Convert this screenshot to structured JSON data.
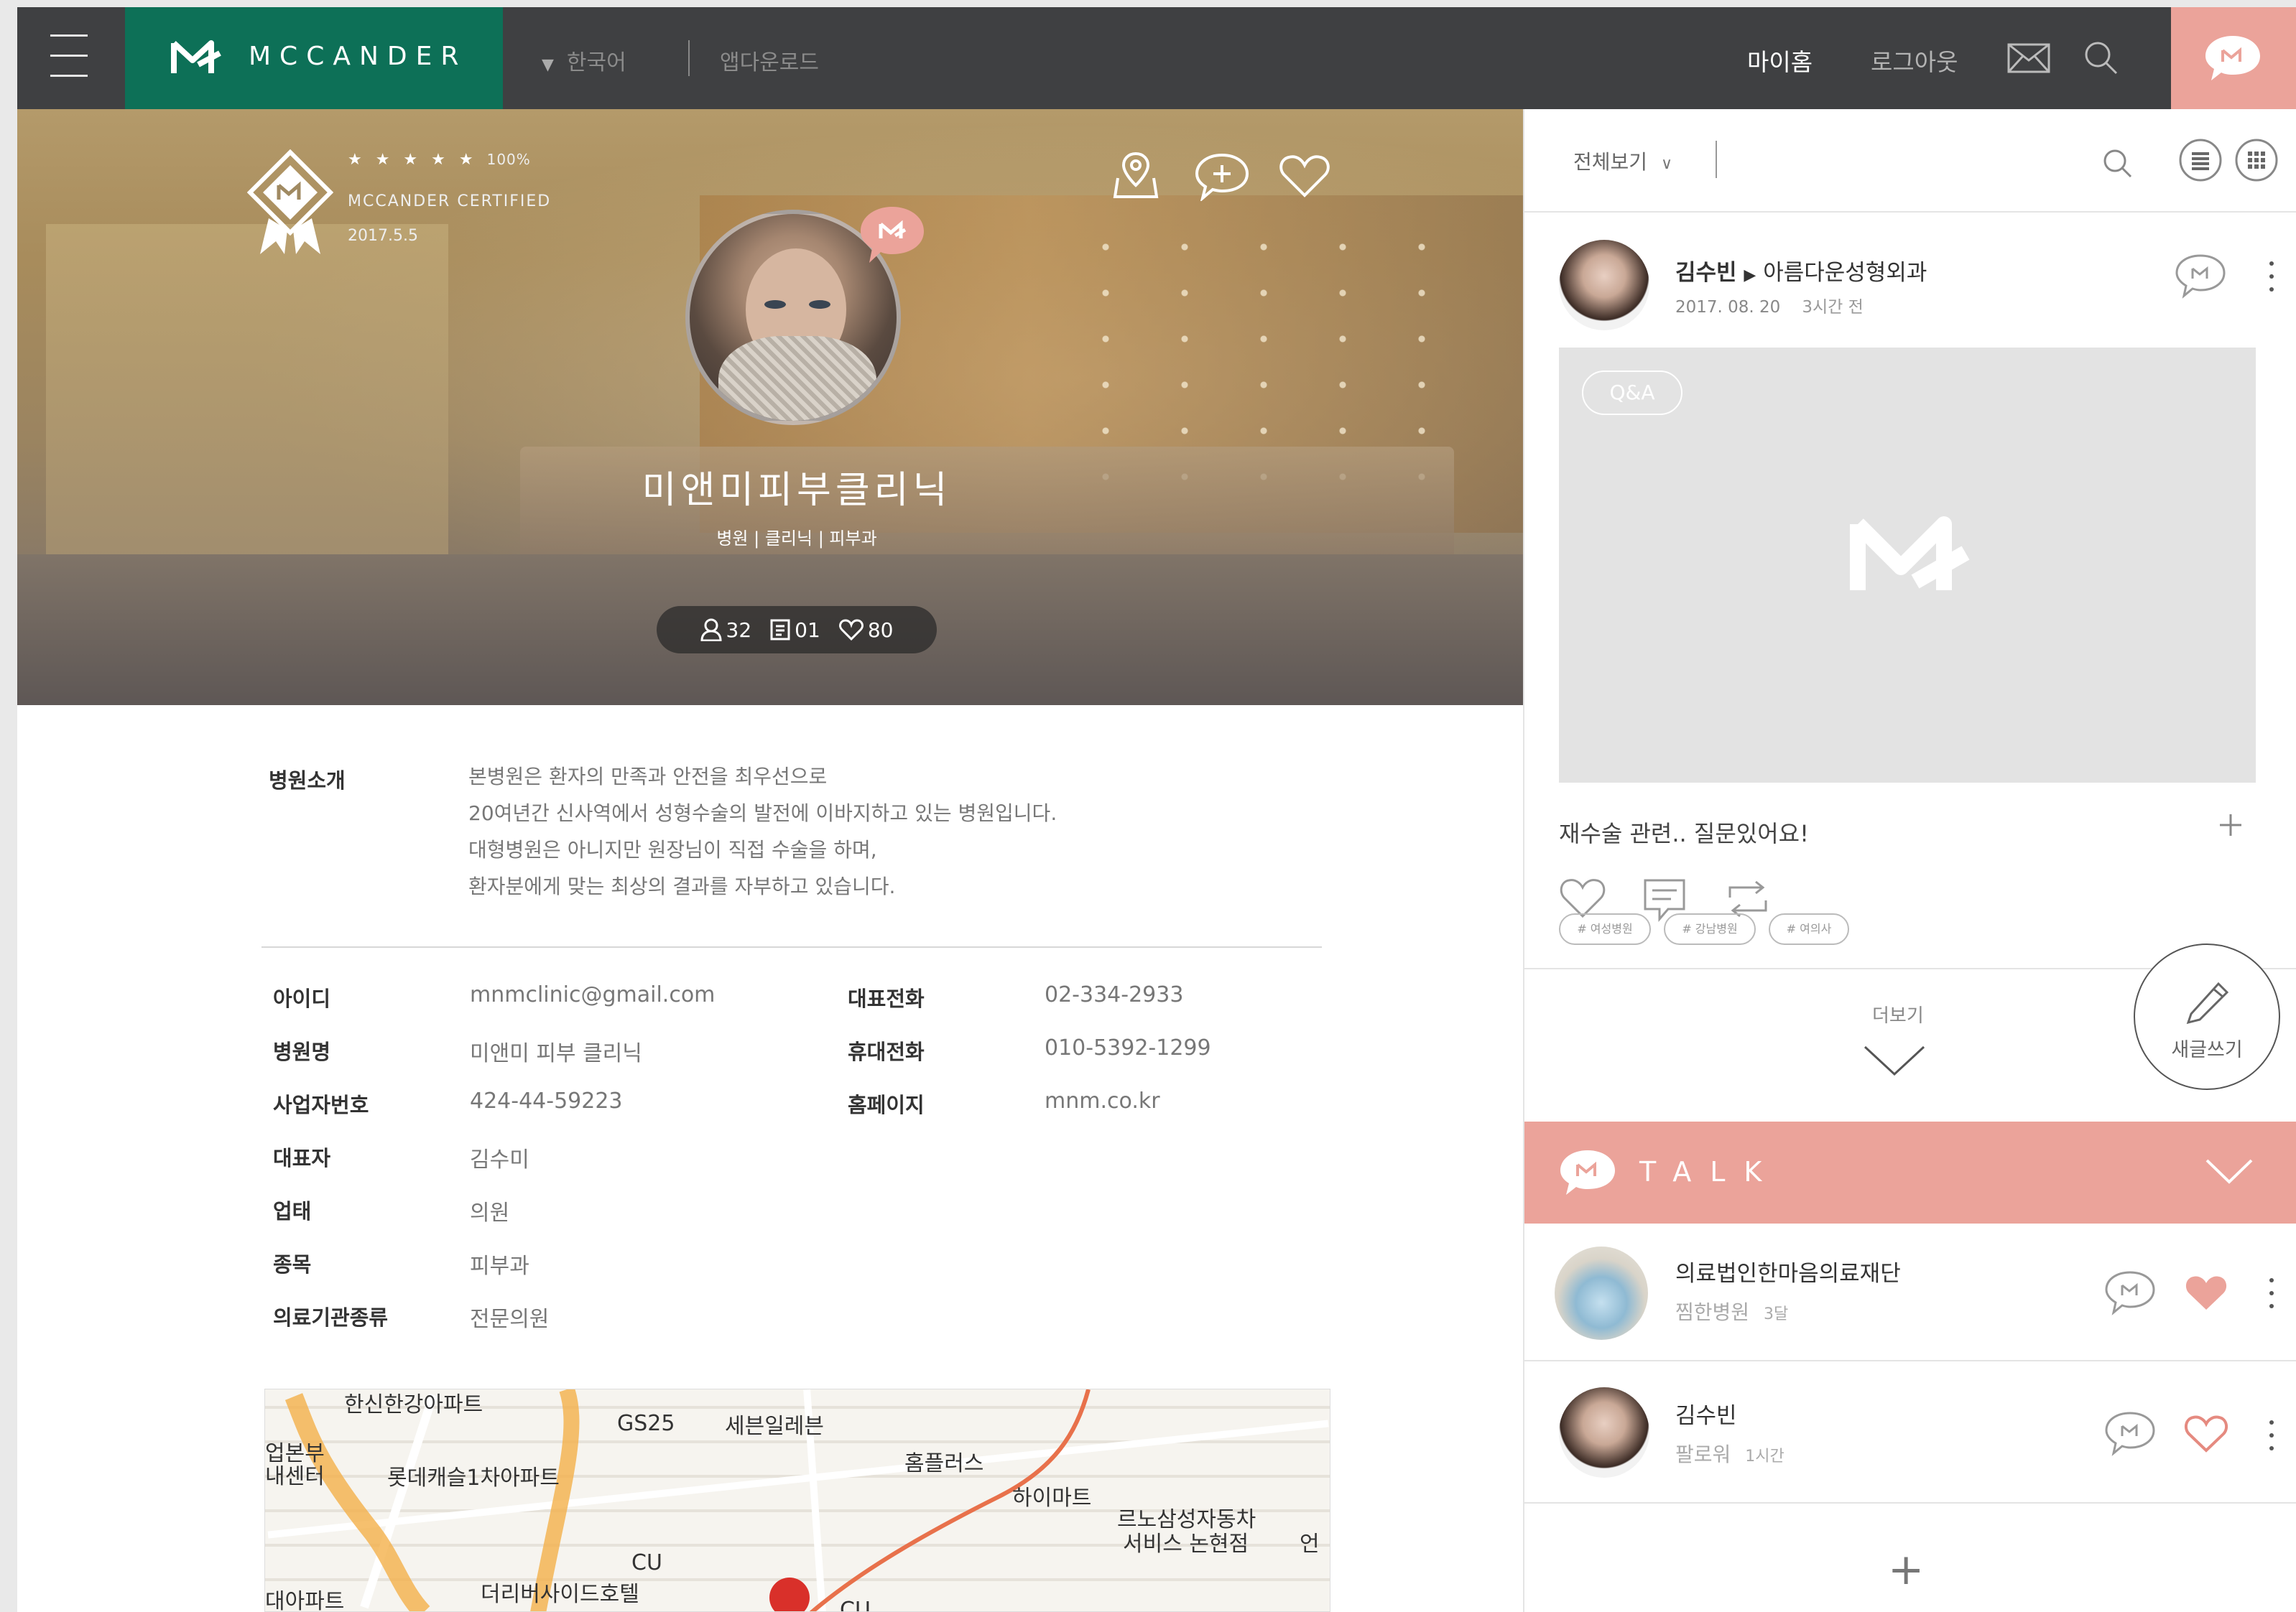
{
  "header": {
    "brand": "MCCANDER",
    "language": "한국어",
    "app_download": "앱다운로드",
    "my_home": "마이홈",
    "logout": "로그아웃"
  },
  "profile": {
    "rating_stars": 5,
    "rating_percent": "100%",
    "certified": "MCCANDER CERTIFIED",
    "certified_date": "2017.5.5",
    "name": "미앤미피부클리닉",
    "category": "병원 | 클리닉 | 피부과",
    "stats": {
      "followers": "32",
      "posts": "01",
      "likes": "80"
    }
  },
  "intro": {
    "label": "병원소개",
    "lines": [
      "본병원은 환자의 만족과 안전을 최우선으로",
      "20여년간 신사역에서 성형수술의 발전에 이바지하고 있는 병원입니다.",
      "대형병원은 아니지만 원장님이 직접 수술을 하며,",
      "환자분에게 맞는 최상의 결과를 자부하고 있습니다."
    ]
  },
  "details": {
    "left": [
      {
        "label": "아이디",
        "value": "mnmclinic@gmail.com"
      },
      {
        "label": "병원명",
        "value": "미앤미 피부 클리닉"
      },
      {
        "label": "사업자번호",
        "value": "424-44-59223"
      },
      {
        "label": "대표자",
        "value": "김수미"
      },
      {
        "label": "업태",
        "value": "의원"
      },
      {
        "label": "종목",
        "value": "피부과"
      },
      {
        "label": "의료기관종류",
        "value": "전문의원"
      }
    ],
    "right": [
      {
        "label": "대표전화",
        "value": "02-334-2933"
      },
      {
        "label": "휴대전화",
        "value": "010-5392-1299"
      },
      {
        "label": "홈페이지",
        "value": "mnm.co.kr"
      }
    ]
  },
  "map": {
    "labels": [
      "한신한강아파트",
      "GS25",
      "세븐일레븐",
      "업본부",
      "내센터",
      "롯데캐슬1차아파트",
      "홈플러스",
      "하이마트",
      "르노삼성자동차",
      "서비스 논현점",
      "CU",
      "대아파트",
      "더리버사이드호텔",
      "CU",
      "언"
    ]
  },
  "sidebar": {
    "filter": "전체보기",
    "post": {
      "author": "김수빈",
      "arrow": "▶",
      "target": "아름다운성형외과",
      "date": "2017. 08. 20",
      "ago": "3시간 전",
      "badge": "Q&A",
      "title": "재수술 관련.. 질문있어요!",
      "tags": [
        "# 여성병원",
        "# 강남병원",
        "# 여의사"
      ]
    },
    "more": "더보기",
    "write": "새글쓰기",
    "talk_title": "TALK",
    "talk_items": [
      {
        "name": "의료법인한마음의료재단",
        "sub": "찜한병원",
        "time": "3달",
        "liked": true
      },
      {
        "name": "김수빈",
        "sub": "팔로워",
        "time": "1시간",
        "liked": false
      }
    ],
    "add": "+"
  },
  "colors": {
    "brand_green": "#0d7057",
    "accent_pink": "#eba39a",
    "topbar": "#3f4042"
  }
}
